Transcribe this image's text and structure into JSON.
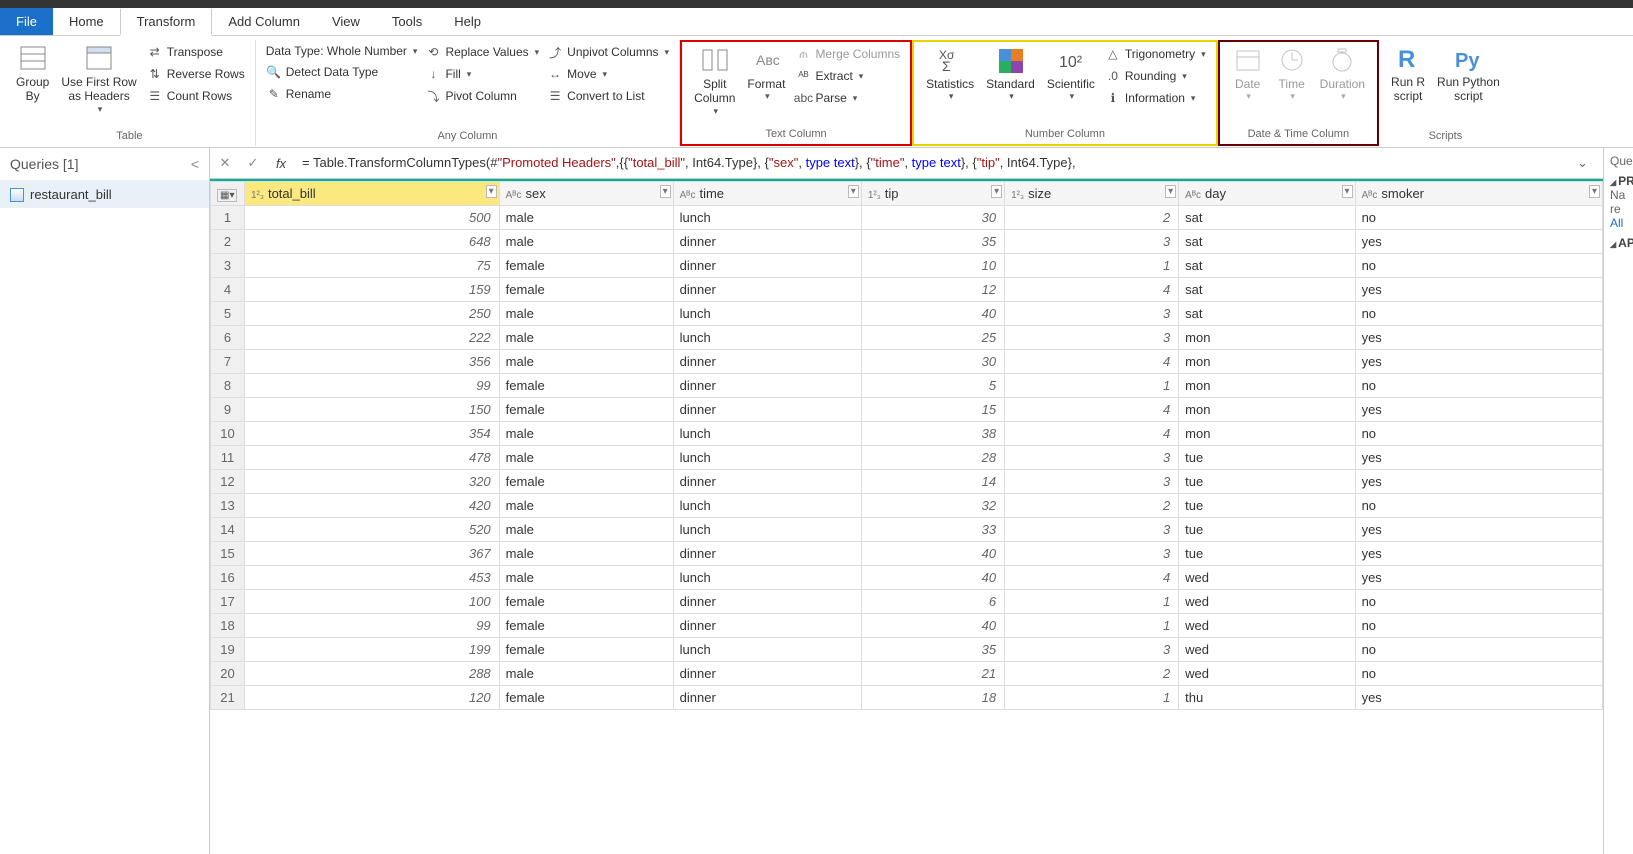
{
  "menu": {
    "file": "File",
    "home": "Home",
    "transform": "Transform",
    "addColumn": "Add Column",
    "view": "View",
    "tools": "Tools",
    "help": "Help"
  },
  "ribbon": {
    "table": {
      "groupBy": "Group\nBy",
      "useFirstRow": "Use First Row\nas Headers",
      "transpose": "Transpose",
      "reverseRows": "Reverse Rows",
      "countRows": "Count Rows",
      "label": "Table"
    },
    "anyColumn": {
      "dataType": "Data Type: Whole Number",
      "replaceValues": "Replace Values",
      "unpivot": "Unpivot Columns",
      "detect": "Detect Data Type",
      "fill": "Fill",
      "move": "Move",
      "rename": "Rename",
      "pivot": "Pivot Column",
      "convert": "Convert to List",
      "label": "Any Column"
    },
    "textColumn": {
      "split": "Split\nColumn",
      "format": "Format",
      "merge": "Merge Columns",
      "extract": "Extract",
      "parse": "Parse",
      "label": "Text Column"
    },
    "numberColumn": {
      "statistics": "Statistics",
      "standard": "Standard",
      "scientific": "Scientific",
      "trig": "Trigonometry",
      "rounding": "Rounding",
      "info": "Information",
      "label": "Number Column"
    },
    "dateTime": {
      "date": "Date",
      "time": "Time",
      "duration": "Duration",
      "label": "Date & Time Column"
    },
    "scripts": {
      "r": "Run R\nscript",
      "py": "Run Python\nscript",
      "label": "Scripts"
    }
  },
  "queries": {
    "header": "Queries [1]",
    "item": "restaurant_bill"
  },
  "formula": {
    "prefix": "= Table.TransformColumnTypes(#",
    "s1": "\"Promoted Headers\"",
    "mid1": ",{{",
    "s2": "\"total_bill\"",
    "mid2": ", Int64.Type}, {",
    "s3": "\"sex\"",
    "mid3": ", ",
    "t1": "type text",
    "mid4": "}, {",
    "s4": "\"time\"",
    "mid5": ", ",
    "t2": "type text",
    "mid6": "}, {",
    "s5": "\"tip\"",
    "mid7": ", Int64.Type},"
  },
  "columns": [
    {
      "name": "total_bill",
      "type": "num",
      "selected": true
    },
    {
      "name": "sex",
      "type": "text"
    },
    {
      "name": "time",
      "type": "text"
    },
    {
      "name": "tip",
      "type": "num"
    },
    {
      "name": "size",
      "type": "num"
    },
    {
      "name": "day",
      "type": "text"
    },
    {
      "name": "smoker",
      "type": "text"
    }
  ],
  "rows": [
    {
      "n": 1,
      "total_bill": 500,
      "sex": "male",
      "time": "lunch",
      "tip": 30,
      "size": 2,
      "day": "sat",
      "smoker": "no"
    },
    {
      "n": 2,
      "total_bill": 648,
      "sex": "male",
      "time": "dinner",
      "tip": 35,
      "size": 3,
      "day": "sat",
      "smoker": "yes"
    },
    {
      "n": 3,
      "total_bill": 75,
      "sex": "female",
      "time": "dinner",
      "tip": 10,
      "size": 1,
      "day": "sat",
      "smoker": "no"
    },
    {
      "n": 4,
      "total_bill": 159,
      "sex": "female",
      "time": "dinner",
      "tip": 12,
      "size": 4,
      "day": "sat",
      "smoker": "yes"
    },
    {
      "n": 5,
      "total_bill": 250,
      "sex": "male",
      "time": "lunch",
      "tip": 40,
      "size": 3,
      "day": "sat",
      "smoker": "no"
    },
    {
      "n": 6,
      "total_bill": 222,
      "sex": "male",
      "time": "lunch",
      "tip": 25,
      "size": 3,
      "day": "mon",
      "smoker": "yes"
    },
    {
      "n": 7,
      "total_bill": 356,
      "sex": "male",
      "time": "dinner",
      "tip": 30,
      "size": 4,
      "day": "mon",
      "smoker": "yes"
    },
    {
      "n": 8,
      "total_bill": 99,
      "sex": "female",
      "time": "dinner",
      "tip": 5,
      "size": 1,
      "day": "mon",
      "smoker": "no"
    },
    {
      "n": 9,
      "total_bill": 150,
      "sex": "female",
      "time": "dinner",
      "tip": 15,
      "size": 4,
      "day": "mon",
      "smoker": "yes"
    },
    {
      "n": 10,
      "total_bill": 354,
      "sex": "male",
      "time": "lunch",
      "tip": 38,
      "size": 4,
      "day": "mon",
      "smoker": "no"
    },
    {
      "n": 11,
      "total_bill": 478,
      "sex": "male",
      "time": "lunch",
      "tip": 28,
      "size": 3,
      "day": "tue",
      "smoker": "yes"
    },
    {
      "n": 12,
      "total_bill": 320,
      "sex": "female",
      "time": "dinner",
      "tip": 14,
      "size": 3,
      "day": "tue",
      "smoker": "yes"
    },
    {
      "n": 13,
      "total_bill": 420,
      "sex": "male",
      "time": "lunch",
      "tip": 32,
      "size": 2,
      "day": "tue",
      "smoker": "no"
    },
    {
      "n": 14,
      "total_bill": 520,
      "sex": "male",
      "time": "lunch",
      "tip": 33,
      "size": 3,
      "day": "tue",
      "smoker": "yes"
    },
    {
      "n": 15,
      "total_bill": 367,
      "sex": "male",
      "time": "dinner",
      "tip": 40,
      "size": 3,
      "day": "tue",
      "smoker": "yes"
    },
    {
      "n": 16,
      "total_bill": 453,
      "sex": "male",
      "time": "lunch",
      "tip": 40,
      "size": 4,
      "day": "wed",
      "smoker": "yes"
    },
    {
      "n": 17,
      "total_bill": 100,
      "sex": "female",
      "time": "dinner",
      "tip": 6,
      "size": 1,
      "day": "wed",
      "smoker": "no"
    },
    {
      "n": 18,
      "total_bill": 99,
      "sex": "female",
      "time": "dinner",
      "tip": 40,
      "size": 1,
      "day": "wed",
      "smoker": "no"
    },
    {
      "n": 19,
      "total_bill": 199,
      "sex": "female",
      "time": "lunch",
      "tip": 35,
      "size": 3,
      "day": "wed",
      "smoker": "no"
    },
    {
      "n": 20,
      "total_bill": 288,
      "sex": "male",
      "time": "dinner",
      "tip": 21,
      "size": 2,
      "day": "wed",
      "smoker": "no"
    },
    {
      "n": 21,
      "total_bill": 120,
      "sex": "female",
      "time": "dinner",
      "tip": 18,
      "size": 1,
      "day": "thu",
      "smoker": "yes"
    }
  ],
  "rightPane": {
    "title": "Que",
    "pr": "PR",
    "na": "Na",
    "re": "re",
    "all": "All",
    "ap": "AP"
  }
}
